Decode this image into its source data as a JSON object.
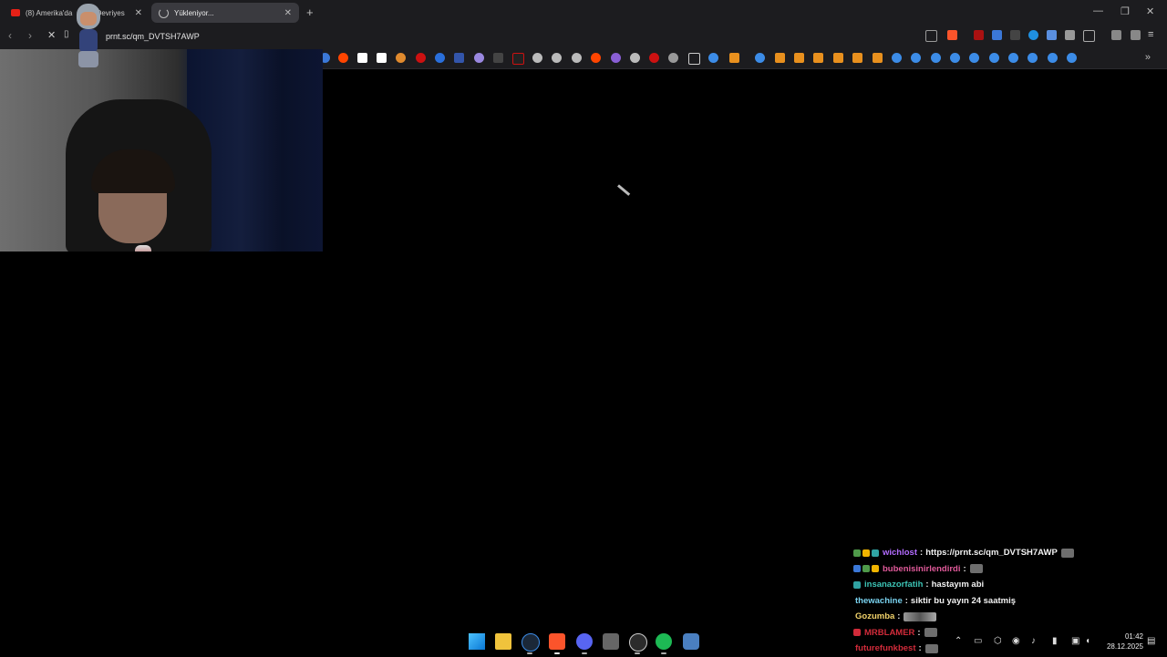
{
  "tabs": [
    {
      "title": "(8) Amerika'da",
      "title_suffix": "ece Devriyes",
      "favicon": "youtube-icon",
      "active": false
    },
    {
      "title": "Yükleniyor...",
      "favicon": "loading-spinner-icon",
      "active": true
    }
  ],
  "toolbar": {
    "url": "prnt.sc/qm_DVTSH7AWP"
  },
  "window_controls": {
    "minimize": "—",
    "restore": "❐",
    "close": "✕"
  },
  "chat": {
    "messages": [
      {
        "user": "wichlost",
        "user_color": "#b36cff",
        "text": "https://prnt.sc/qm_DVTSH7AWP",
        "badges": [
          "#4f9a4a",
          "#f0b400",
          "#30a3a3"
        ],
        "emote": true
      },
      {
        "user": "bubenisinirlendirdi",
        "user_color": "#e05a9a",
        "text": "",
        "badges": [
          "#3b78d8",
          "#4f9a4a",
          "#f0b400"
        ],
        "emote": true
      },
      {
        "user": "insanazorfatih",
        "user_color": "#3cc3b5",
        "text": "hastayım abi",
        "badges": [
          "#30a3a3"
        ],
        "emote": false
      },
      {
        "user": "thewachine",
        "user_color": "#7ad3f0",
        "text": "siktir bu yayın 24 saatmiş",
        "badges": [],
        "emote": false
      },
      {
        "user": "Gozumba",
        "user_color": "#f2d36b",
        "text": "",
        "badges": [],
        "emote": "wide"
      },
      {
        "user": "MRBLAMER",
        "user_color": "#d12b3a",
        "text": "",
        "badges": [
          "#d12b3a"
        ],
        "emote": true
      },
      {
        "user": "futurefunkbest",
        "user_color": "#d12b3a",
        "text": "",
        "badges": [],
        "emote": true
      }
    ]
  },
  "clock": {
    "time": "01:42",
    "date": "28.12.2025"
  },
  "colors": {
    "accent": "#fb542b",
    "chrome": "#1c1c1f"
  }
}
